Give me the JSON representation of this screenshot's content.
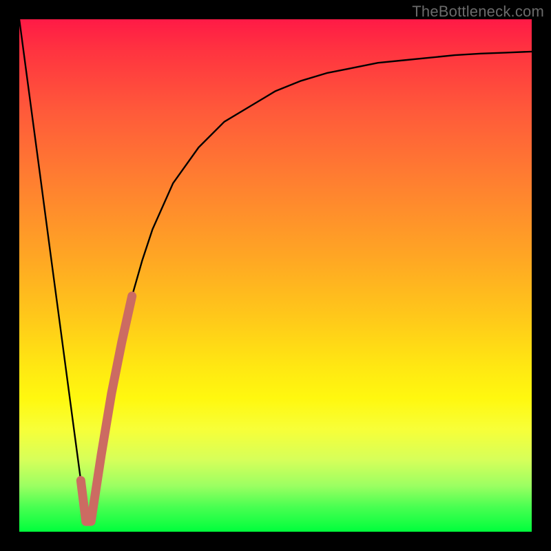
{
  "watermark": "TheBottleneck.com",
  "colors": {
    "frame_bg": "#000000",
    "curve": "#000000",
    "highlight": "#cc6b62",
    "gradient_top": "#ff1a46",
    "gradient_bottom": "#00ff3c"
  },
  "chart_data": {
    "type": "line",
    "title": "",
    "xlabel": "",
    "ylabel": "",
    "xlim": [
      0,
      100
    ],
    "ylim": [
      0,
      100
    ],
    "series": [
      {
        "name": "bottleneck-curve",
        "x": [
          0,
          2,
          4,
          6,
          8,
          10,
          12,
          13,
          14,
          16,
          18,
          20,
          22,
          24,
          26,
          30,
          35,
          40,
          45,
          50,
          55,
          60,
          65,
          70,
          75,
          80,
          85,
          90,
          95,
          100
        ],
        "values": [
          100,
          85,
          70,
          55,
          40,
          25,
          10,
          2,
          2,
          15,
          27,
          37,
          46,
          53,
          59,
          68,
          75,
          80,
          83,
          86,
          88,
          89.5,
          90.5,
          91.5,
          92,
          92.5,
          93,
          93.3,
          93.5,
          93.7
        ]
      },
      {
        "name": "highlight-segment",
        "x": [
          12,
          13,
          14,
          16,
          18,
          20,
          22
        ],
        "values": [
          10,
          2,
          2,
          15,
          27,
          37,
          46
        ]
      }
    ],
    "annotations": []
  }
}
